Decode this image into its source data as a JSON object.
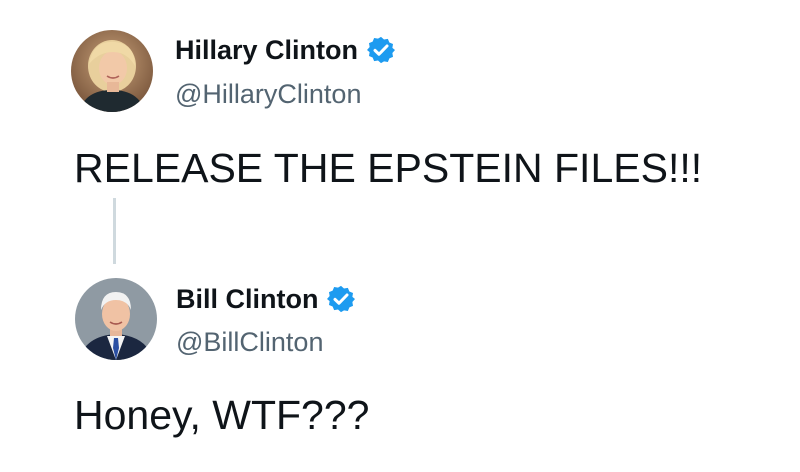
{
  "thread": [
    {
      "display_name": "Hillary Clinton",
      "handle": "@HillaryClinton",
      "text": "RELEASE THE EPSTEIN FILES!!!",
      "verified": true,
      "avatar_icon": "profile-photo-woman"
    },
    {
      "display_name": "Bill Clinton",
      "handle": "@BillClinton",
      "text": "Honey, WTF???",
      "verified": true,
      "avatar_icon": "profile-photo-man-suit"
    }
  ],
  "colors": {
    "verified_badge": "#1d9bf0",
    "handle_text": "#536471",
    "body_text": "#0f1419",
    "thread_line": "#cfd9de"
  }
}
